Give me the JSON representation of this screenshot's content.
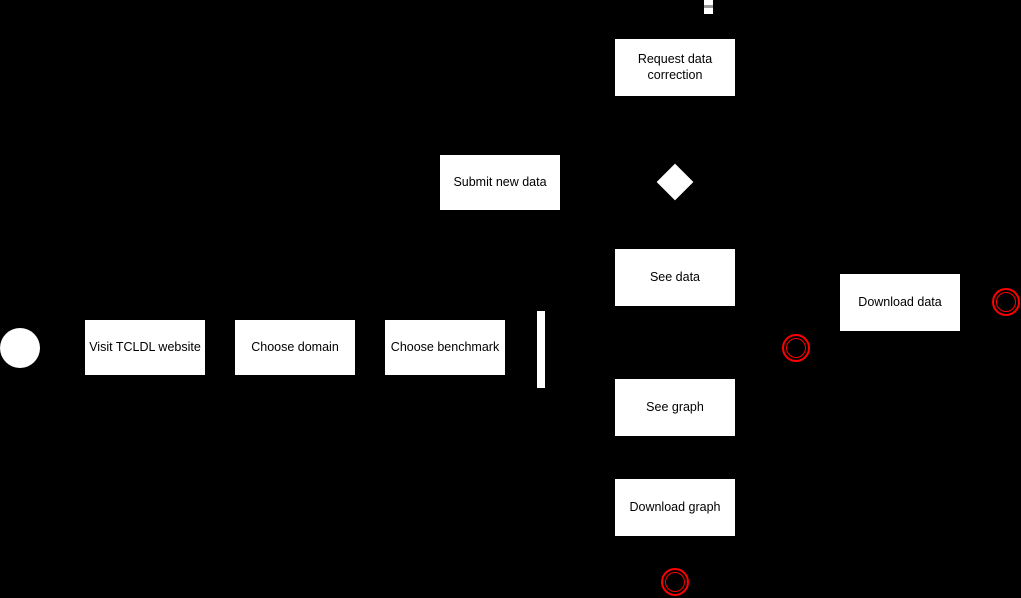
{
  "diagram": {
    "type": "uml-activity-diagram",
    "background_color": "#000000",
    "node_fill": "#ffffff",
    "node_text_color": "#000000",
    "final_node_color": "#ff0000",
    "nodes": {
      "initial": {
        "name": "initial-node"
      },
      "actions": [
        {
          "id": "visit-tcldl-website",
          "label": "Visit TCLDL website"
        },
        {
          "id": "choose-domain",
          "label": "Choose domain"
        },
        {
          "id": "choose-benchmark",
          "label": "Choose benchmark"
        },
        {
          "id": "submit-new-data",
          "label": "Submit new data"
        },
        {
          "id": "request-data-correction",
          "label": "Request data\ncorrection"
        },
        {
          "id": "see-data",
          "label": "See data"
        },
        {
          "id": "see-graph",
          "label": "See graph"
        },
        {
          "id": "download-graph",
          "label": "Download graph"
        },
        {
          "id": "download-data",
          "label": "Download data"
        }
      ],
      "fork": {
        "name": "fork-bar"
      },
      "decision": {
        "name": "decision-diamond"
      },
      "finals": [
        {
          "id": "final-center"
        },
        {
          "id": "final-right"
        },
        {
          "id": "final-bottom"
        }
      ],
      "fragment": {
        "name": "clipped-fragment-top"
      }
    }
  }
}
